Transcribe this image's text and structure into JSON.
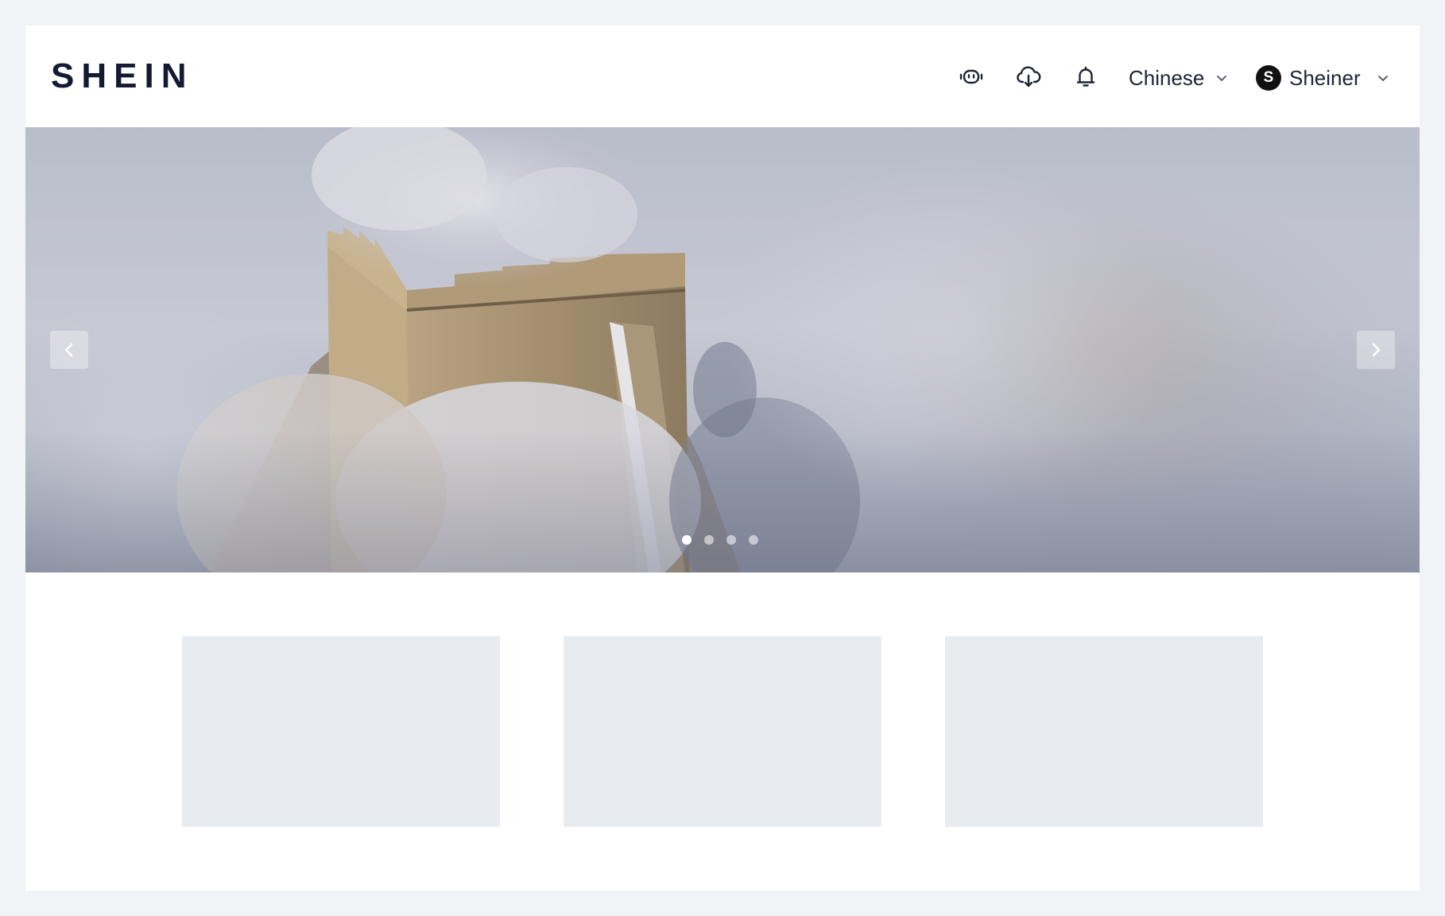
{
  "header": {
    "logo": "SHEIN",
    "icons": [
      "robot-icon",
      "cloud-download-icon",
      "bell-icon"
    ],
    "language": {
      "label": "Chinese"
    },
    "user": {
      "avatar_letter": "S",
      "name": "Sheiner"
    }
  },
  "carousel": {
    "image": "great-wall-winter-fog",
    "prev_icon": "chevron-left-icon",
    "next_icon": "chevron-right-icon",
    "slide_count": 4,
    "active_index": 0
  },
  "content": {
    "placeholder_cards": 3
  },
  "colors": {
    "page_background": "#f1f3f6",
    "card_background": "#ffffff",
    "logo": "#151a33",
    "placeholder": "#e8ebf0",
    "avatar": "#111111"
  }
}
